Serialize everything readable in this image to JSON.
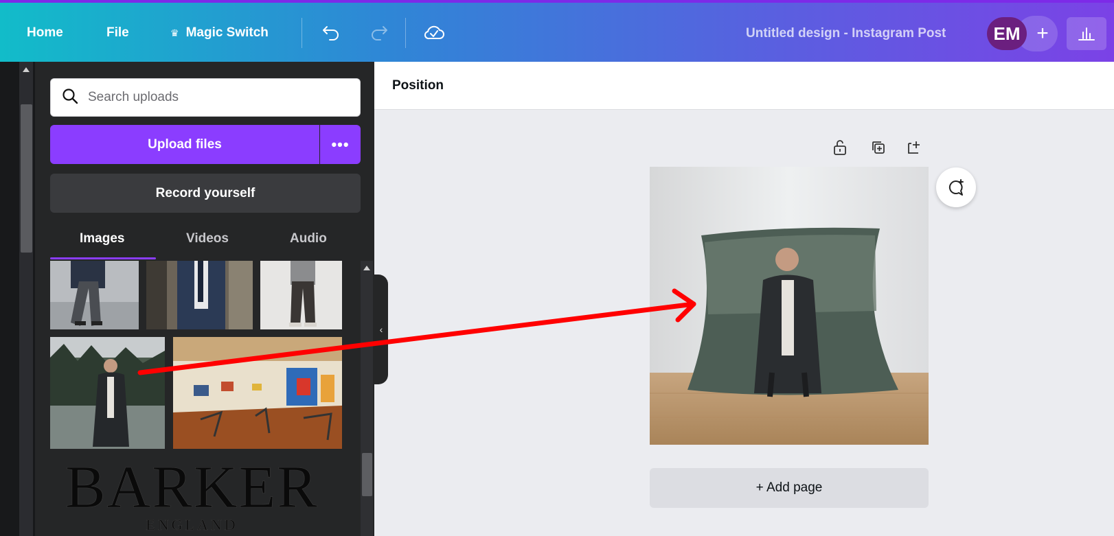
{
  "topbar": {
    "home_label": "Home",
    "file_label": "File",
    "magic_switch_label": "Magic Switch",
    "doc_title": "Untitled design - Instagram Post",
    "avatar_initials": "EM",
    "add_collaborator": "+"
  },
  "panel": {
    "search_placeholder": "Search uploads",
    "upload_label": "Upload files",
    "upload_more": "•••",
    "record_label": "Record yourself",
    "tabs": [
      {
        "label": "Images",
        "active": true
      },
      {
        "label": "Videos",
        "active": false
      },
      {
        "label": "Audio",
        "active": false
      }
    ],
    "collapse_icon": "‹",
    "logo_text": "BARKER",
    "logo_subtext": "ENGLAND"
  },
  "toolbar": {
    "position_label": "Position"
  },
  "canvas": {
    "add_page_label": "+ Add page"
  },
  "colors": {
    "accent": "#8b3dff",
    "annotation_arrow": "#ff0000"
  }
}
